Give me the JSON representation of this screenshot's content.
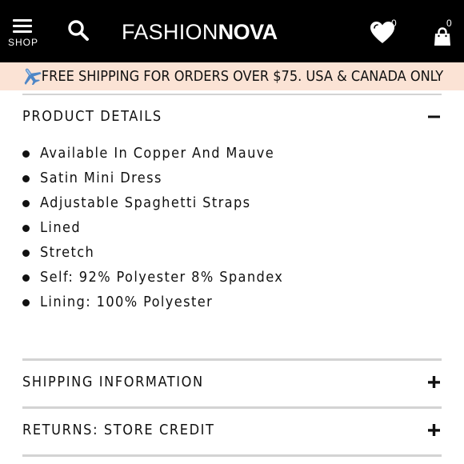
{
  "header": {
    "menu_label": "SHOP",
    "logo_light": "FASHION",
    "logo_bold": "NOVA",
    "wishlist_count": "0",
    "cart_count": "0"
  },
  "banner": {
    "text": "FREE SHIPPING FOR ORDERS OVER $75. USA & CANADA ONLY"
  },
  "product_details": {
    "title": "PRODUCT DETAILS",
    "state": "expanded",
    "items": [
      "Available In Copper And Mauve",
      "Satin Mini Dress",
      "Adjustable Spaghetti Straps",
      "Lined",
      "Stretch",
      "Self: 92% Polyester 8% Spandex",
      "Lining: 100% Polyester"
    ]
  },
  "shipping": {
    "title": "SHIPPING INFORMATION",
    "state": "collapsed"
  },
  "returns": {
    "title": "RETURNS: STORE CREDIT",
    "state": "collapsed"
  },
  "colors": {
    "header_bg": "#000000",
    "banner_bg": "#fbe3d5",
    "divider": "#d3d3d3",
    "text": "#111111"
  },
  "icons": [
    "hamburger-menu-icon",
    "search-icon",
    "heart-icon",
    "shopping-bag-icon",
    "airplane-icon",
    "minus-icon",
    "plus-icon",
    "bullet-icon"
  ]
}
